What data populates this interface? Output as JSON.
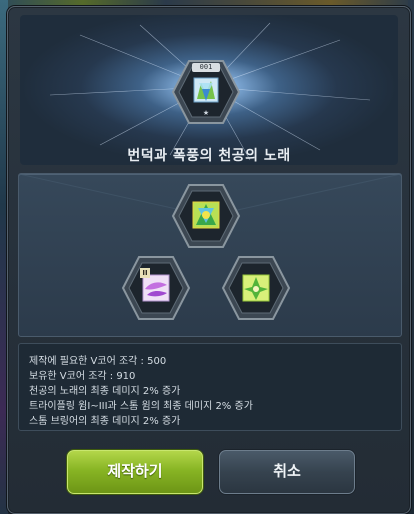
{
  "dialog": {
    "core_badge": "001",
    "title": "번덕과 폭풍의 천공의 노래",
    "info_lines": [
      "제작에 필요한 V코어 조각 : 500",
      "보유한 V코어 조각 : 910",
      "천공의 노래의 최종 데미지 2% 증가",
      "트라이플링 윔I~III과 스톰 윔의 최종 데미지 2% 증가",
      "스톰 브링어의 최종 데미지 2% 증가"
    ],
    "skill_level_badge": "II",
    "make_button": "제작하기",
    "cancel_button": "취소"
  },
  "colors": {
    "make_button": "#88b524",
    "cancel_button": "#36434f",
    "panel": "#2c3b4b",
    "text": "#d5dde4"
  },
  "icons": {
    "core": "wind-core-icon",
    "skill_top": "song-of-sky-skill-icon",
    "skill_left": "trifling-wind-skill-icon",
    "skill_right": "storm-bringer-skill-icon"
  }
}
